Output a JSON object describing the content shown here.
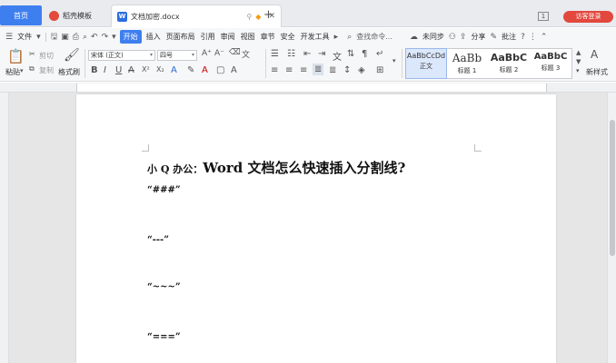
{
  "tabs": {
    "home": "首页",
    "template": "稻壳模板",
    "doc": "文档加密.docx",
    "doc_logo": "W",
    "add": "+",
    "counter": "1",
    "login": "访客登录"
  },
  "menu": {
    "file": "文件",
    "active": "开始",
    "items": [
      "插入",
      "页面布局",
      "引用",
      "审阅",
      "视图",
      "章节",
      "安全",
      "开发工具"
    ],
    "search": "查找命令...",
    "sync": "未同步",
    "share": "分享",
    "comment": "批注"
  },
  "ribbon": {
    "paste": "粘贴",
    "cut": "剪切",
    "copy": "复制",
    "format_painter": "格式刷",
    "font_name": "宋体 (正文)",
    "font_size": "四号",
    "styles": [
      {
        "sample": "AaBbCcDd",
        "caption": "正文",
        "selected": true
      },
      {
        "sample": "AaBb",
        "caption": "标题 1",
        "selected": false
      },
      {
        "sample": "AaBbC",
        "caption": "标题 2",
        "selected": false
      },
      {
        "sample": "AaBbC",
        "caption": "标题 3",
        "selected": false
      }
    ],
    "new_style": "新样式"
  },
  "document": {
    "title_prefix": "小 Q 办公：",
    "title": "Word 文档怎么快速插入分割线?",
    "lines": [
      "“###”",
      "“---”",
      "“~~~”",
      "“===”"
    ]
  },
  "colors": {
    "accent": "#3e7ff0",
    "login": "#e2483d"
  }
}
